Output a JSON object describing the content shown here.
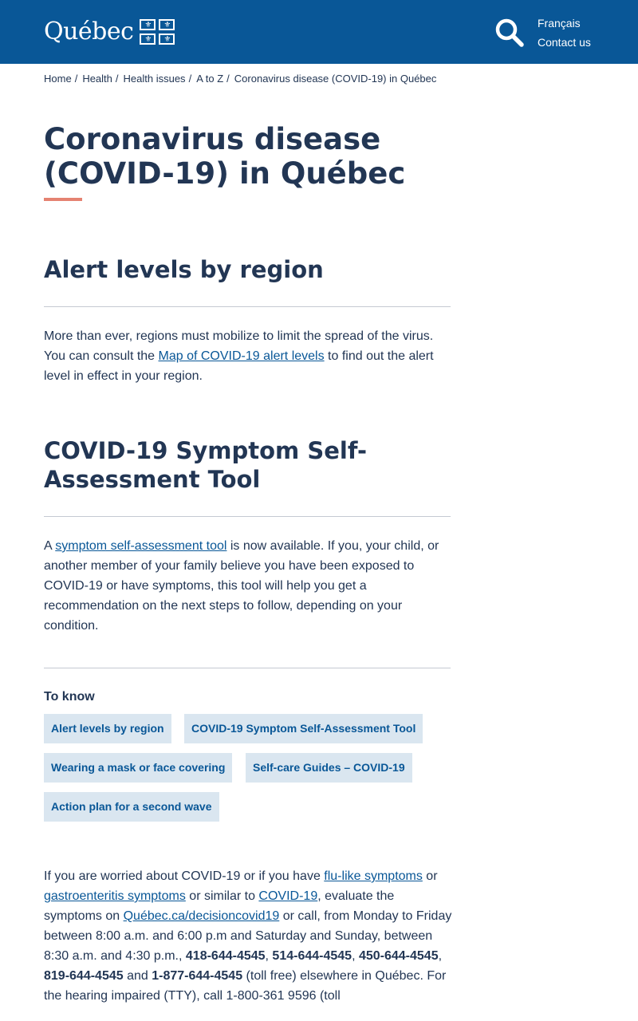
{
  "header": {
    "logo_text": "Québec",
    "logo_flag_symbol": "⚜",
    "search_icon": "magnifier",
    "links": [
      "Français",
      "Contact us"
    ],
    "bg_color": "#095797"
  },
  "breadcrumb": [
    "Home",
    "Health",
    "Health issues",
    "A to Z",
    "Coronavirus disease (COVID-19) in Québec"
  ],
  "breadcrumb_separator": "/",
  "page_title": "Coronavirus disease (COVID-19) in Québec",
  "sections": {
    "alert": {
      "heading": "Alert levels by region",
      "text_before": "More than ever, regions must mobilize to limit the spread of the virus. You can consult the ",
      "link": "Map of COVID-19 alert levels",
      "text_after": " to find out the alert level in effect in your region."
    },
    "self_assessment": {
      "heading": "COVID-19 Symptom Self-Assessment Tool",
      "text_before": "A ",
      "link": "symptom self-assessment tool",
      "text_after": " is now available. If you, your child, or another member of your family believe you have been exposed to COVID-19 or have symptoms, this tool will help you get a recommendation on the next steps to follow, depending on your condition."
    }
  },
  "to_know": {
    "label": "To know",
    "chips": [
      "Alert levels by region",
      "COVID-19 Symptom Self-Assessment Tool",
      "Wearing a mask or face covering",
      "Self-care Guides – COVID-19",
      "Action plan for a second wave"
    ]
  },
  "worried": {
    "t1": "If you are worried about COVID-19 or if you have ",
    "link_flu": "flu-like symptoms",
    "t2": " or ",
    "link_gastro": "gastroenteritis symptoms",
    "t3": " or similar to ",
    "link_covid": "COVID-19",
    "t4": ", evaluate the symptoms on ",
    "link_site": "Québec.ca/decisioncovid19",
    "t5": " or call, from Monday to Friday between 8:00 a.m. and 6:00 p.m and Saturday and Sunday, between 8:30 a.m. and 4:30 p.m., ",
    "phone1": "418-644-4545",
    "phone2": "514-644-4545",
    "phone3": "450-644-4545",
    "phone4": "819-644-4545",
    "t6": " and ",
    "phone5": "1-877-644-4545",
    "t7": " (toll free) elsewhere in Québec. For the hearing impaired (TTY), call 1-800-361 9596 (toll"
  }
}
